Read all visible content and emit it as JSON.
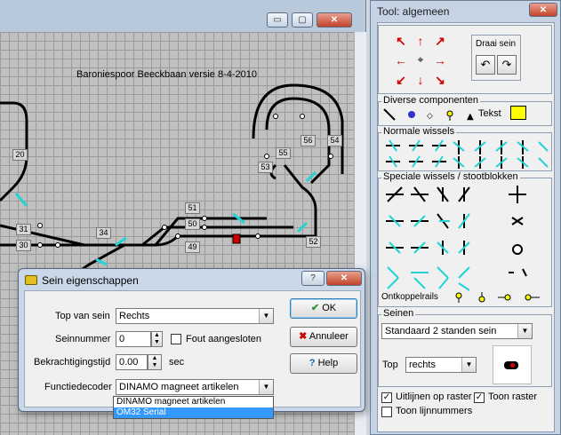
{
  "main_window": {
    "layout_title": "Baroniespoor Beeckbaan versie 8-4-2010",
    "caption_buttons": {
      "minimize": "▭",
      "maximize": "▢",
      "close": "✕"
    },
    "track_labels": [
      "20",
      "53",
      "55",
      "56",
      "54",
      "31",
      "30",
      "34",
      "51",
      "50",
      "49",
      "52"
    ]
  },
  "tool_window": {
    "title": "Tool: algemeen",
    "close_label": "✕",
    "draai_sein_label": "Draai sein",
    "rotate_left_icon": "↶",
    "rotate_right_icon": "↷",
    "diverse_label": "Diverse componenten",
    "tekst_label": "Tekst",
    "normale_label": "Normale wissels",
    "speciale_label": "Speciale wissels / stootblokken",
    "ontkoppel_label": "Ontkoppelrails",
    "seinen_label": "Seinen",
    "seinen_select": "Standaard 2 standen sein",
    "top_label": "Top",
    "top_select": "rechts",
    "uitlijnen_label": "Uitlijnen op raster",
    "uitlijnen_checked": "✓",
    "toon_raster_label": "Toon raster",
    "toon_raster_checked": "✓",
    "toon_lijnnummers_label": "Toon lijnnummers",
    "accent_color": "#ffff00"
  },
  "dialog": {
    "title": "Sein eigenschappen",
    "help_caption": "?",
    "close_caption": "✕",
    "top_van_sein_label": "Top van sein",
    "top_van_sein_value": "Rechts",
    "seinnummer_label": "Seinnummer",
    "seinnummer_value": "0",
    "fout_label": "Fout aangesloten",
    "bekrachtigingstijd_label": "Bekrachtigingstijd",
    "bekrachtigingstijd_value": "0.00",
    "sec_label": "sec",
    "functiedecoder_label": "Functiedecoder",
    "functiedecoder_value": "DINAMO magneet artikelen",
    "ok_label": "OK",
    "annuleer_label": "Annuleer",
    "help_label": "Help",
    "dropdown_options": [
      "DINAMO magneet artikelen",
      "OM32 Serial"
    ]
  }
}
